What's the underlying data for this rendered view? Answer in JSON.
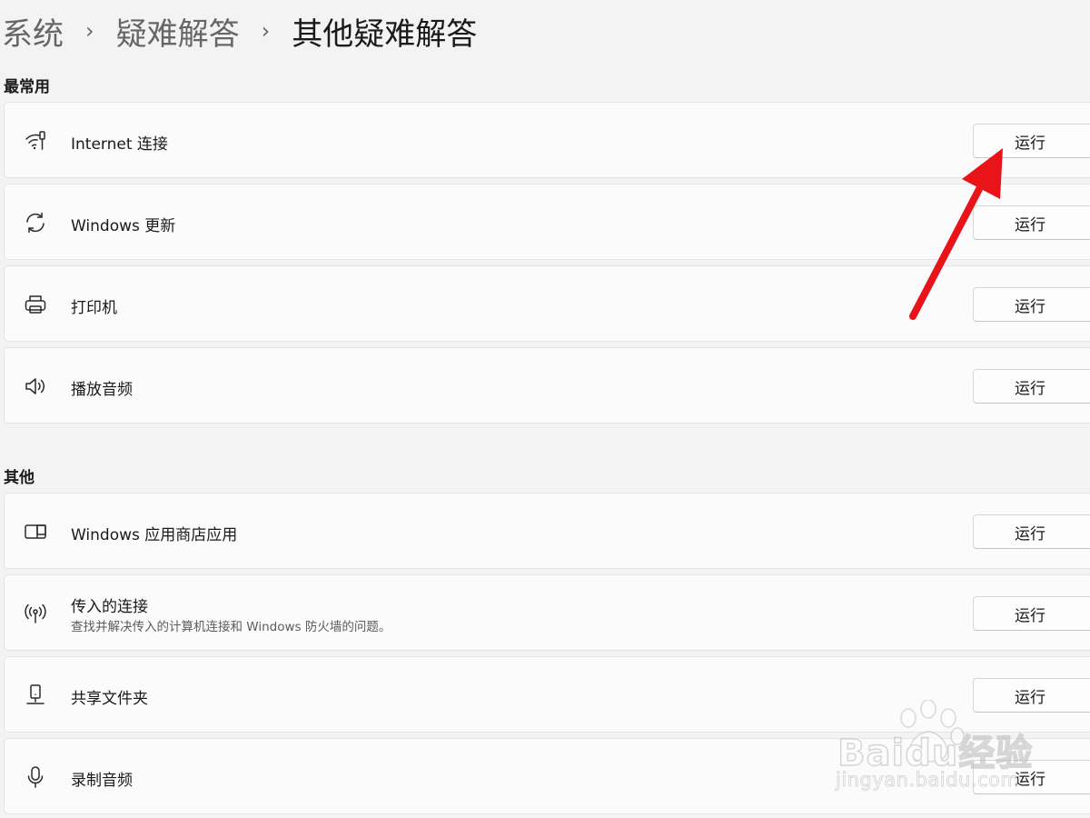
{
  "breadcrumb": {
    "items": [
      "系统",
      "疑难解答"
    ],
    "current": "其他疑难解答",
    "separator": "›"
  },
  "sections": {
    "frequent": {
      "heading": "最常用",
      "items": [
        {
          "title": "Internet 连接",
          "icon": "wifi-icon",
          "button": "运行"
        },
        {
          "title": "Windows 更新",
          "icon": "refresh-icon",
          "button": "运行"
        },
        {
          "title": "打印机",
          "icon": "printer-icon",
          "button": "运行"
        },
        {
          "title": "播放音频",
          "icon": "speaker-icon",
          "button": "运行"
        }
      ]
    },
    "other": {
      "heading": "其他",
      "items": [
        {
          "title": "Windows 应用商店应用",
          "icon": "store-app-icon",
          "button": "运行"
        },
        {
          "title": "传入的连接",
          "description": "查找并解决传入的计算机连接和 Windows 防火墙的问题。",
          "icon": "antenna-icon",
          "button": "运行"
        },
        {
          "title": "共享文件夹",
          "icon": "shared-folder-icon",
          "button": "运行"
        },
        {
          "title": "录制音频",
          "icon": "microphone-icon",
          "button": "运行"
        }
      ]
    }
  },
  "annotation": {
    "color": "#e8141a"
  },
  "watermark": {
    "logo": "Baidu经验",
    "url": "jingyan.baidu.com"
  }
}
